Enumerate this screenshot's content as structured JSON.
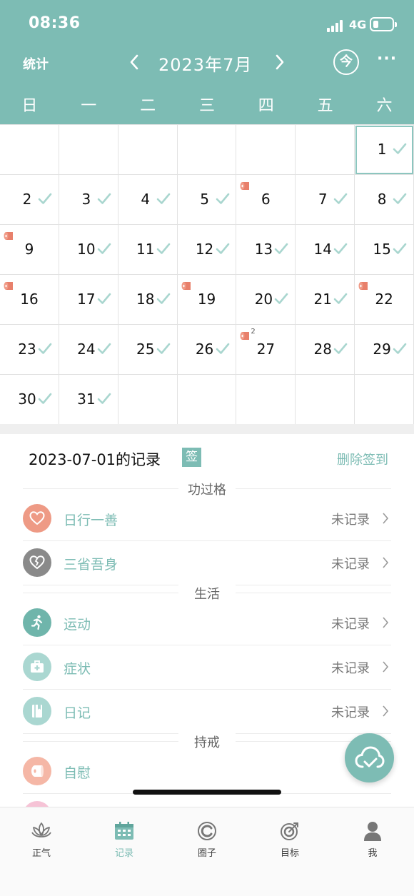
{
  "status_bar": {
    "time": "08:36",
    "network": "4G"
  },
  "header": {
    "stats_label": "统计",
    "month_title": "2023年7月",
    "today_label": "今",
    "more_label": "···"
  },
  "weekdays": [
    "日",
    "一",
    "二",
    "三",
    "四",
    "五",
    "六"
  ],
  "calendar": {
    "days": [
      {
        "day": "1",
        "checked": true,
        "roll": false,
        "selected": true
      },
      {
        "day": "2",
        "checked": true,
        "roll": false
      },
      {
        "day": "3",
        "checked": true,
        "roll": false
      },
      {
        "day": "4",
        "checked": true,
        "roll": false
      },
      {
        "day": "5",
        "checked": true,
        "roll": false
      },
      {
        "day": "6",
        "checked": false,
        "roll": true
      },
      {
        "day": "7",
        "checked": true,
        "roll": false
      },
      {
        "day": "8",
        "checked": true,
        "roll": false
      },
      {
        "day": "9",
        "checked": false,
        "roll": true
      },
      {
        "day": "10",
        "checked": true,
        "roll": false
      },
      {
        "day": "11",
        "checked": true,
        "roll": false
      },
      {
        "day": "12",
        "checked": true,
        "roll": false
      },
      {
        "day": "13",
        "checked": true,
        "roll": false
      },
      {
        "day": "14",
        "checked": true,
        "roll": false
      },
      {
        "day": "15",
        "checked": true,
        "roll": false
      },
      {
        "day": "16",
        "checked": false,
        "roll": true
      },
      {
        "day": "17",
        "checked": true,
        "roll": false
      },
      {
        "day": "18",
        "checked": true,
        "roll": false
      },
      {
        "day": "19",
        "checked": false,
        "roll": true
      },
      {
        "day": "20",
        "checked": true,
        "roll": false
      },
      {
        "day": "21",
        "checked": true,
        "roll": false
      },
      {
        "day": "22",
        "checked": false,
        "roll": true
      },
      {
        "day": "23",
        "checked": true,
        "roll": false
      },
      {
        "day": "24",
        "checked": true,
        "roll": false
      },
      {
        "day": "25",
        "checked": true,
        "roll": false
      },
      {
        "day": "26",
        "checked": true,
        "roll": false
      },
      {
        "day": "27",
        "checked": false,
        "roll": true,
        "roll_count": "2"
      },
      {
        "day": "28",
        "checked": true,
        "roll": false
      },
      {
        "day": "29",
        "checked": true,
        "roll": false
      },
      {
        "day": "30",
        "checked": true,
        "roll": false
      },
      {
        "day": "31",
        "checked": true,
        "roll": false
      }
    ]
  },
  "records": {
    "title": "2023-07-01的记录",
    "sign_badge": "签",
    "delete_label": "删除签到",
    "sections": [
      {
        "title": "功过格",
        "items": [
          {
            "label": "日行一善",
            "status": "未记录",
            "icon": "heart-icon",
            "color": "#ee9a85"
          },
          {
            "label": "三省吾身",
            "status": "未记录",
            "icon": "broken-heart-icon",
            "color": "#8a8a8a"
          }
        ]
      },
      {
        "title": "生活",
        "items": [
          {
            "label": "运动",
            "status": "未记录",
            "icon": "running-icon",
            "color": "#6fb5ab"
          },
          {
            "label": "症状",
            "status": "未记录",
            "icon": "medical-kit-icon",
            "color": "#aad7d1"
          },
          {
            "label": "日记",
            "status": "未记录",
            "icon": "diary-icon",
            "color": "#aad7d1"
          }
        ]
      },
      {
        "title": "持戒",
        "items": [
          {
            "label": "自慰",
            "status": "",
            "icon": "tissue-roll-icon",
            "color": "#f5b7a6"
          }
        ]
      }
    ]
  },
  "tabbar": {
    "items": [
      {
        "label": "正气",
        "icon": "lotus-icon",
        "active": false
      },
      {
        "label": "记录",
        "icon": "calendar-icon",
        "active": true
      },
      {
        "label": "圈子",
        "icon": "circle-icon",
        "active": false
      },
      {
        "label": "目标",
        "icon": "target-icon",
        "active": false
      },
      {
        "label": "我",
        "icon": "person-icon",
        "active": false
      }
    ]
  },
  "colors": {
    "primary": "#7dbcb4",
    "check": "#a9d6cf",
    "roll": "#e8806b"
  }
}
